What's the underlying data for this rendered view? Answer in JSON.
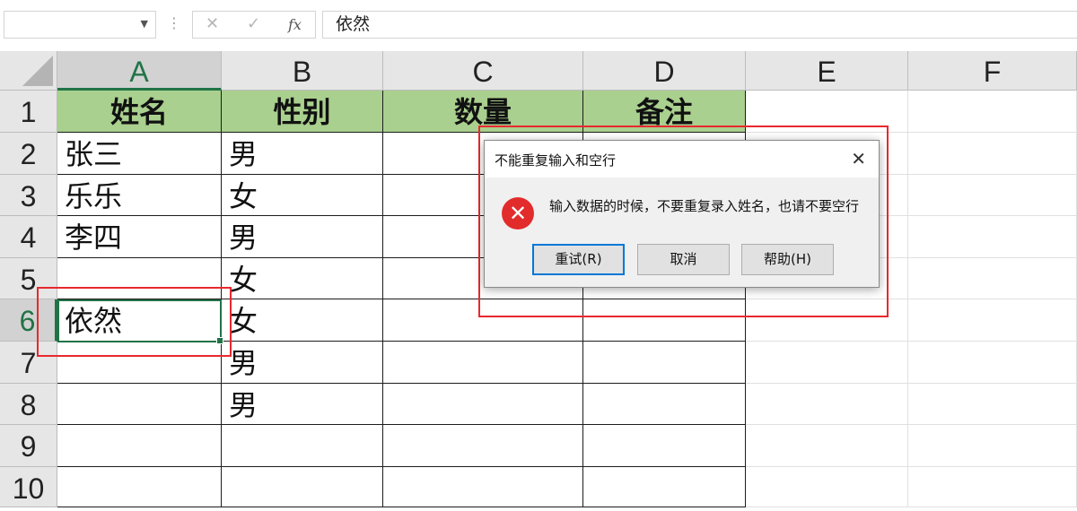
{
  "formula_bar": {
    "name_box": "",
    "fx_label": "fx",
    "content": "依然"
  },
  "columns": [
    "A",
    "B",
    "C",
    "D",
    "E",
    "F"
  ],
  "rows": [
    "1",
    "2",
    "3",
    "4",
    "5",
    "6",
    "7",
    "8",
    "9",
    "10"
  ],
  "table": {
    "headers": [
      "姓名",
      "性别",
      "数量",
      "备注"
    ],
    "rows": [
      [
        "张三",
        "男",
        "",
        ""
      ],
      [
        "乐乐",
        "女",
        "",
        ""
      ],
      [
        "李四",
        "男",
        "",
        ""
      ],
      [
        "",
        "女",
        "",
        ""
      ],
      [
        "依然",
        "女",
        "",
        ""
      ],
      [
        "",
        "男",
        "",
        ""
      ],
      [
        "",
        "男",
        "",
        ""
      ]
    ]
  },
  "selected_cell": "A6",
  "dialog": {
    "title": "不能重复输入和空行",
    "message": "输入数据的时候，不要重复录入姓名，也请不要空行",
    "icon": "error-icon",
    "buttons": {
      "retry": "重试(R)",
      "cancel": "取消",
      "help": "帮助(H)"
    }
  },
  "colors": {
    "header_fill": "#a9d08e",
    "selection": "#217346",
    "annotation": "#e8282e",
    "error": "#e22b2b"
  }
}
